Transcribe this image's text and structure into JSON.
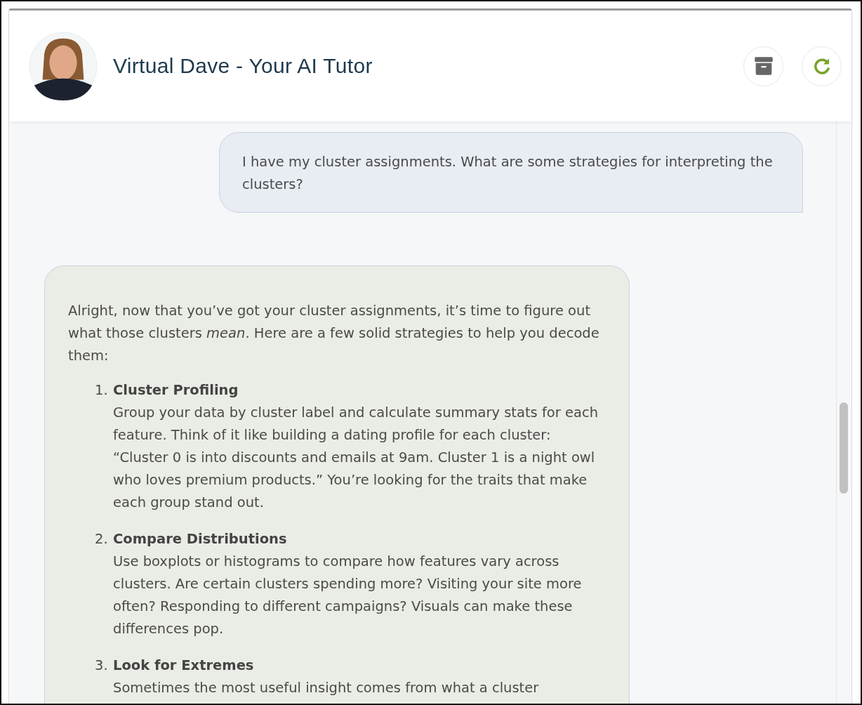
{
  "header": {
    "title": "Virtual Dave - Your AI Tutor",
    "buttons": [
      {
        "kind": "archive"
      },
      {
        "kind": "refresh"
      }
    ]
  },
  "messages": [
    {
      "kind": "user",
      "text": "I have my cluster assignments. What are some strategies for interpreting the clusters?"
    },
    {
      "kind": "assistant",
      "intro": "Alright, now that you’ve got your cluster assignments, it’s time to figure out what those clusters *mean*. Here are a few solid strategies to help you decode them:",
      "items": [
        {
          "number": "1.",
          "title": "Cluster Profiling",
          "body": "Group your data by cluster label and calculate summary stats for each feature. Think of it like building a dating profile for each cluster: “Cluster 0 is into discounts and emails at 9am. Cluster 1 is a night owl who loves premium products.” You’re looking for the traits that make each group stand out."
        },
        {
          "number": "2.",
          "title": "Compare Distributions",
          "body": "Use boxplots or histograms to compare how features vary across clusters. Are certain clusters spending more? Visiting your site more often? Responding to different campaigns? Visuals can make these differences pop."
        },
        {
          "number": "3.",
          "title": "Look for Extremes",
          "body": "Sometimes the most useful insight comes from what a cluster"
        }
      ]
    }
  ]
}
